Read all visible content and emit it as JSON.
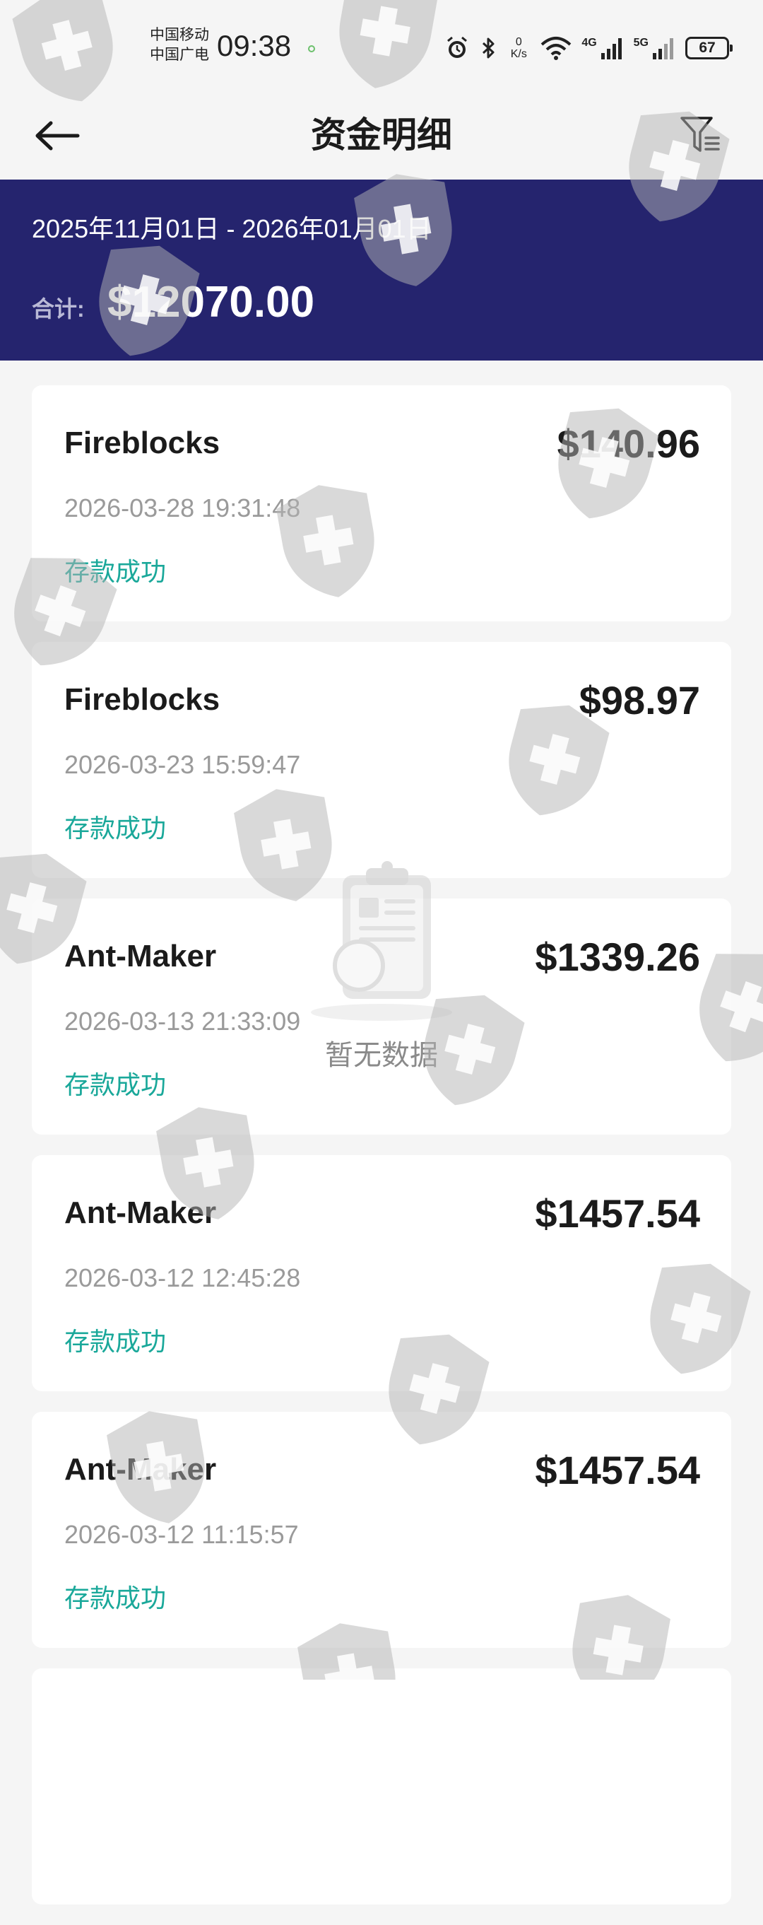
{
  "status_bar": {
    "carrier_1": "中国移动",
    "carrier_2": "中国广电",
    "time": "09:38",
    "net_speed_value": "0",
    "net_speed_unit": "K/s",
    "net_4g": "4G",
    "net_5g": "5G",
    "battery": "67"
  },
  "header": {
    "title": "资金明细",
    "back_icon": "arrow-left-icon",
    "filter_icon": "filter-icon"
  },
  "summary": {
    "date_range": "2025年11月01日 - 2026年01月01日",
    "total_label": "合计:",
    "total_value": "$12070.00",
    "background_color": "#25246e"
  },
  "transactions": [
    {
      "name": "Fireblocks",
      "amount": "$140.96",
      "time": "2026-03-28 19:31:48",
      "status": "存款成功"
    },
    {
      "name": "Fireblocks",
      "amount": "$98.97",
      "time": "2026-03-23 15:59:47",
      "status": "存款成功"
    },
    {
      "name": "Ant-Maker",
      "amount": "$1339.26",
      "time": "2026-03-13 21:33:09",
      "status": "存款成功"
    },
    {
      "name": "Ant-Maker",
      "amount": "$1457.54",
      "time": "2026-03-12 12:45:28",
      "status": "存款成功"
    },
    {
      "name": "Ant-Maker",
      "amount": "$1457.54",
      "time": "2026-03-12 11:15:57",
      "status": "存款成功"
    }
  ],
  "empty_state": {
    "text": "暂无数据",
    "icon": "clipboard-empty-icon"
  },
  "colors": {
    "status_success": "#1aa89a",
    "watermark": "shield-plus-icon"
  }
}
